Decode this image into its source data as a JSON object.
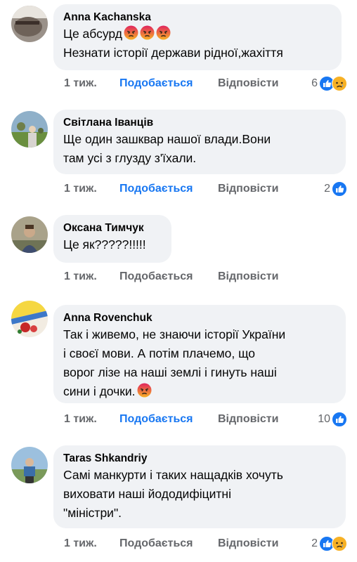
{
  "comments": [
    {
      "author": "Anna Kachanska",
      "lines": [
        "Це абсурд",
        "Незнати історії держави рідної,жахіття"
      ],
      "time": "1 тиж.",
      "like_label": "Подобається",
      "liked": true,
      "reply_label": "Відповісти",
      "reaction_count": "6",
      "reactions": [
        "like",
        "sad"
      ],
      "inline_emoji": [
        "angry-face",
        "angry-face",
        "angry-face"
      ]
    },
    {
      "author": "Світлана Іванців",
      "lines": [
        "Ще один зашквар нашої влади.Вони",
        "там усі з глузду з'їхали."
      ],
      "time": "1 тиж.",
      "like_label": "Подобається",
      "liked": true,
      "reply_label": "Відповісти",
      "reaction_count": "2",
      "reactions": [
        "like"
      ]
    },
    {
      "author": "Оксана Тимчук",
      "lines": [
        "Це як?????!!!!!"
      ],
      "time": "1 тиж.",
      "like_label": "Подобається",
      "liked": false,
      "reply_label": "Відповісти",
      "reaction_count": "",
      "reactions": []
    },
    {
      "author": "Anna Rovenchuk",
      "lines": [
        "Так і живемо, не знаючи історії України",
        "і своєї мови. А потім плачемо, що",
        "ворог лізе на наші землі і гинуть наші",
        "сини і дочки."
      ],
      "time": "1 тиж.",
      "like_label": "Подобається",
      "liked": true,
      "reply_label": "Відповісти",
      "reaction_count": "10",
      "reactions": [
        "like"
      ],
      "inline_emoji": [
        "angry-face"
      ]
    },
    {
      "author": "Taras Shkandriy",
      "lines": [
        "Самі манкурти і таких нащадків хочуть",
        "виховати наші йододифіцитні",
        "\"міністри\"."
      ],
      "time": "1 тиж.",
      "like_label": "Подобається",
      "liked": false,
      "reply_label": "Відповісти",
      "reaction_count": "2",
      "reactions": [
        "like",
        "sad"
      ]
    }
  ],
  "colors": {
    "bubble": "#f0f2f5",
    "like_blue": "#1877f2",
    "meta_gray": "#65676b",
    "angry": "#e9710f",
    "sad": "#f7b125"
  }
}
